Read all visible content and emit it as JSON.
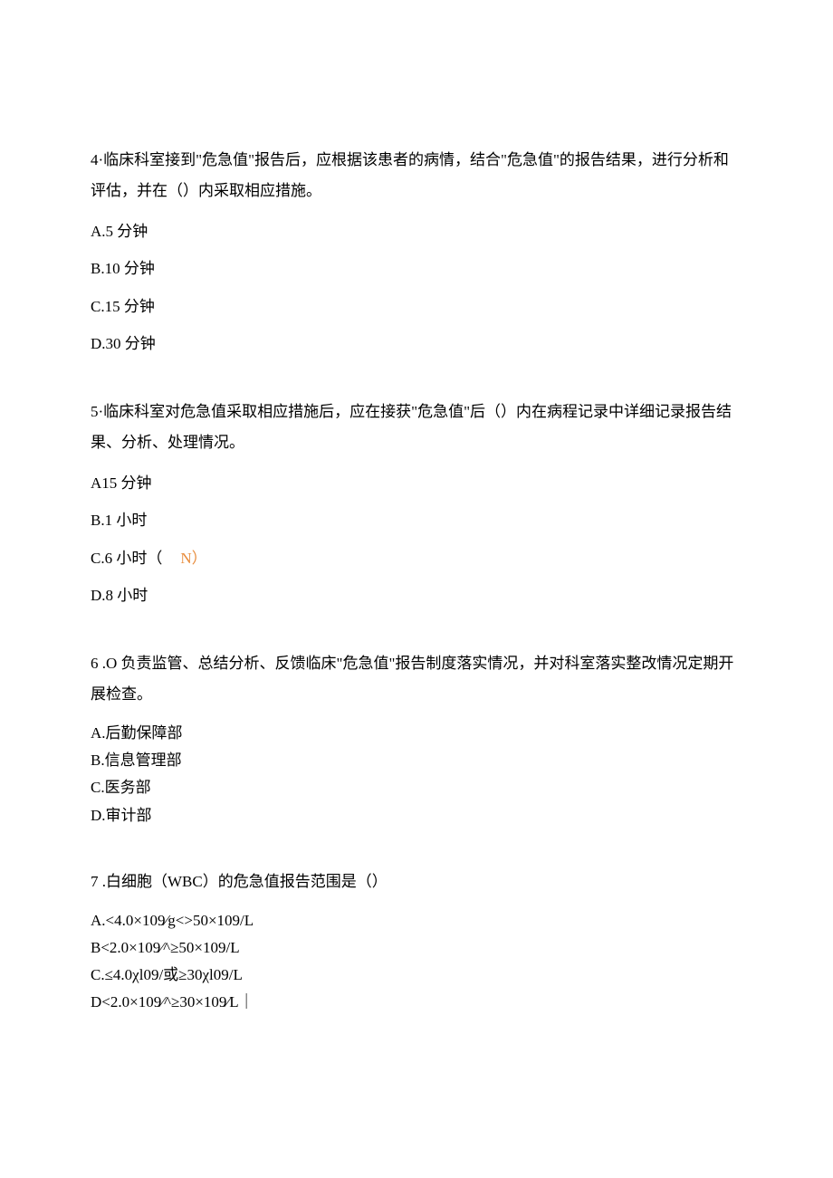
{
  "questions": [
    {
      "id": "q4",
      "text": "4·临床科室接到\"危急值\"报告后，应根据该患者的病情，结合\"危急值\"的报告结果，进行分析和评估，并在（）内采取相应措施。",
      "options": [
        {
          "label": "A.5 分钟"
        },
        {
          "label": "B.10 分钟"
        },
        {
          "label": "C.15 分钟"
        },
        {
          "label": "D.30 分钟"
        }
      ]
    },
    {
      "id": "q5",
      "text": "5·临床科室对危急值采取相应措施后，应在接获\"危急值\"后（）内在病程记录中详细记录报告结果、分析、处理情况。",
      "options": [
        {
          "label": "A15 分钟"
        },
        {
          "label": "B.1 小时"
        },
        {
          "label": "C.6 小时（",
          "mark": "N）"
        },
        {
          "label": "D.8 小时"
        }
      ]
    },
    {
      "id": "q6",
      "text": "6 .O 负责监管、总结分析、反馈临床\"危急值\"报告制度落实情况，并对科室落实整改情况定期开展检查。",
      "options": [
        {
          "label": "A.后勤保障部"
        },
        {
          "label": "B.信息管理部"
        },
        {
          "label": "C.医务部"
        },
        {
          "label": "D.审计部"
        }
      ]
    },
    {
      "id": "q7",
      "text": "7 .白细胞（WBC）的危急值报告范围是（）",
      "options": [
        {
          "label": "A.<4.0×109⁄g<>50×109/L"
        },
        {
          "label": "B<2.0×109⁄^≥50×109/L"
        },
        {
          "label": "C.≤4.0χl09/或≥30χl09/L"
        },
        {
          "label": "D<2.0×109⁄^≥30×109⁄L｜"
        }
      ]
    }
  ]
}
